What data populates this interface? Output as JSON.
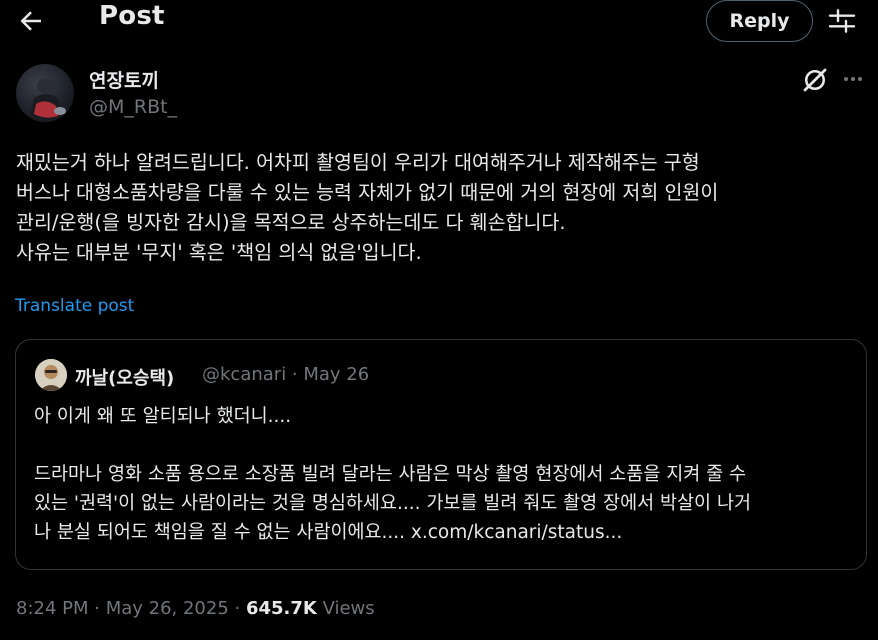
{
  "header": {
    "title": "Post",
    "reply_label": "Reply",
    "back_icon": "arrow-left-icon",
    "tune_icon": "sliders-icon"
  },
  "author": {
    "display_name": "연장토끼",
    "handle": "@M_RBt_",
    "grok_icon": "grok-icon",
    "more_icon": "more-icon"
  },
  "tweet": {
    "lines": [
      "재밌는거 하나 알려드립니다. 어차피 촬영팀이 우리가 대여해주거나 제작해주는 구형",
      "버스나 대형소품차량을 다룰 수 있는 능력 자체가 없기 때문에 거의 현장에 저희 인원이",
      "관리/운행(을 빙자한 감시)을 목적으로 상주하는데도 다 훼손합니다.",
      "사유는 대부분 '무지' 혹은 '책임 의식 없음'입니다."
    ],
    "translate_label": "Translate post"
  },
  "quote": {
    "name": "까날(오승택)",
    "meta": "@kcanari · May 26",
    "line1": "아 이게 왜 또 알티되나 했더니....",
    "lines": [
      "드라마나 영화 소품 용으로 소장품 빌려 달라는 사람은 막상 촬영 현장에서 소품을 지켜 줄 수",
      "있는 '권력'이 없는 사람이라는 것을 명심하세요.... 가보를 빌려 줘도 촬영 장에서 박살이 나거",
      "나 분실 되어도 책임을 질 수 없는 사람이에요.... x.com/kcanari/status..."
    ]
  },
  "footer": {
    "timestamp": "8:24 PM · May 26, 2025 · ",
    "views_count": "645.7K",
    "views_label": " Views"
  },
  "colors": {
    "background": "#000000",
    "text": "#e7e9ea",
    "muted": "#71767b",
    "link": "#1d9bf0",
    "border": "#2f3336"
  }
}
